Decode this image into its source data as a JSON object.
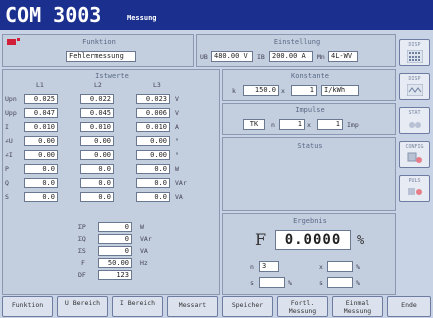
{
  "title": {
    "main": "COM 3003",
    "sub": "Messung"
  },
  "funktion": {
    "label": "Funktion",
    "value": "Fehlermessung"
  },
  "einstellung": {
    "label": "Einstellung",
    "ub_label": "UB",
    "ub_value": "480.00 V",
    "ib_label": "IB",
    "ib_value": "200.00 A",
    "mn_label": "Mn",
    "mn_value": "4L-WV"
  },
  "istwerte": {
    "label": "Istwerte",
    "columns": [
      "L1",
      "L2",
      "L3"
    ],
    "rows": [
      {
        "name": "Upn",
        "values": [
          "0.025",
          "0.022",
          "0.023"
        ],
        "unit": "V"
      },
      {
        "name": "Upp",
        "values": [
          "0.047",
          "0.045",
          "0.006"
        ],
        "unit": "V"
      },
      {
        "name": "I",
        "values": [
          "0.010",
          "0.010",
          "0.010"
        ],
        "unit": "A"
      },
      {
        "name": "∠U",
        "values": [
          "0.00",
          "0.00",
          "0.00"
        ],
        "unit": "°"
      },
      {
        "name": "∠I",
        "values": [
          "0.00",
          "0.00",
          "0.00"
        ],
        "unit": "°"
      },
      {
        "name": "P",
        "values": [
          "0.0",
          "0.0",
          "0.0"
        ],
        "unit": "W"
      },
      {
        "name": "Q",
        "values": [
          "0.0",
          "0.0",
          "0.0"
        ],
        "unit": "VAr"
      },
      {
        "name": "S",
        "values": [
          "0.0",
          "0.0",
          "0.0"
        ],
        "unit": "VA"
      }
    ],
    "sums": [
      {
        "name": "ΣP",
        "value": "0",
        "unit": "W"
      },
      {
        "name": "ΣQ",
        "value": "0",
        "unit": "VAr"
      },
      {
        "name": "ΣS",
        "value": "0",
        "unit": "VA"
      },
      {
        "name": "F",
        "value": "50.00",
        "unit": "Hz"
      },
      {
        "name": "DF",
        "value": "123",
        "unit": ""
      }
    ]
  },
  "konstante": {
    "label": "Konstante",
    "k_label": "k",
    "k_value": "150.0",
    "times": "x",
    "factor": "1",
    "unit": "I/kWh"
  },
  "impulse": {
    "label": "Impulse",
    "source": "TK",
    "n_label": "n",
    "n_value": "1",
    "times": "x",
    "count": "1",
    "unit": "Imp"
  },
  "status": {
    "label": "Status"
  },
  "ergebnis": {
    "label": "Ergebnis",
    "f_label": "F",
    "f_value": "0.0000",
    "f_unit": "%",
    "n_label": "n",
    "n_value": "3",
    "x_label": "x",
    "s_label": "s"
  },
  "sidebar": [
    {
      "label": "DISP"
    },
    {
      "label": "DISP"
    },
    {
      "label": "STAT"
    },
    {
      "label": "CONFIG"
    },
    {
      "label": "PULS"
    }
  ],
  "bottom": [
    {
      "label": "Funktion"
    },
    {
      "label": "U Bereich"
    },
    {
      "label": "I Bereich"
    },
    {
      "label": "Messart"
    },
    {
      "label": "Speicher"
    },
    {
      "label": "Fortl. Messung"
    },
    {
      "label": "Einmal Messung"
    },
    {
      "label": "Ende"
    }
  ],
  "colors": {
    "titlebar": "#1b2f8e",
    "background": "#c8d4e6",
    "accent_red": "#d11f3a"
  }
}
